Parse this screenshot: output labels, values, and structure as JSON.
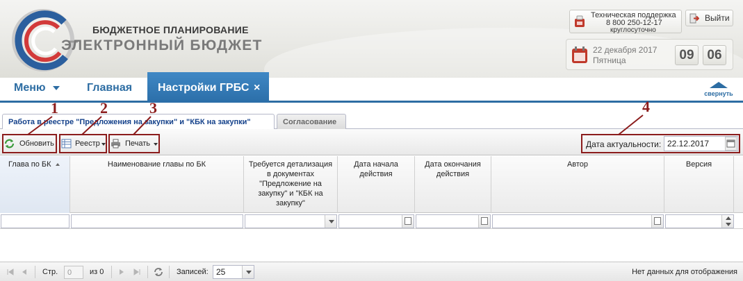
{
  "colors": {
    "accent": "#2d6da3",
    "annotation": "#8b1c1c",
    "tab_active": "#3f88c5"
  },
  "header": {
    "brand_line1": "БЮДЖЕТНОЕ ПЛАНИРОВАНИЕ",
    "brand_line2": "ЭЛЕКТРОННЫЙ БЮДЖЕТ",
    "support": {
      "line1": "Техническая поддержка",
      "phone": "8 800 250-12-17",
      "hours": "круглосуточно",
      "icon": "phone-icon"
    },
    "logout_label": "Выйти",
    "date": "22 декабря 2017",
    "weekday": "Пятница",
    "clock_hours": "09",
    "clock_minutes": "06"
  },
  "nav": {
    "menu_label": "Меню",
    "main_label": "Главная",
    "active_tab_label": "Настройки ГРБС",
    "close_glyph": "×",
    "collapse_label": "свернуть"
  },
  "subtabs": [
    {
      "label": "Работа в реестре \"Предложения на закупки\" и \"КБК на закупки\"",
      "active": true
    },
    {
      "label": "Согласование",
      "active": false
    }
  ],
  "toolbar": {
    "refresh_label": "Обновить",
    "registry_label": "Реестр",
    "print_label": "Печать",
    "date_actual_label": "Дата актуальности:",
    "date_actual_value": "22.12.2017"
  },
  "annotations": [
    "1",
    "2",
    "3",
    "4"
  ],
  "grid": {
    "columns": [
      "Глава по БК",
      "Наименование главы по БК",
      "Требуется детализация в документах \"Предложение на закупку\" и \"КБК на закупку\"",
      "Дата начала действия",
      "Дата окончания действия",
      "Автор",
      "Версия"
    ],
    "rows": []
  },
  "pager": {
    "page_label": "Стр.",
    "page_value": "0",
    "of_label": "из 0",
    "records_label": "Записей:",
    "page_size": "25",
    "empty_text": "Нет данных для отображения"
  }
}
